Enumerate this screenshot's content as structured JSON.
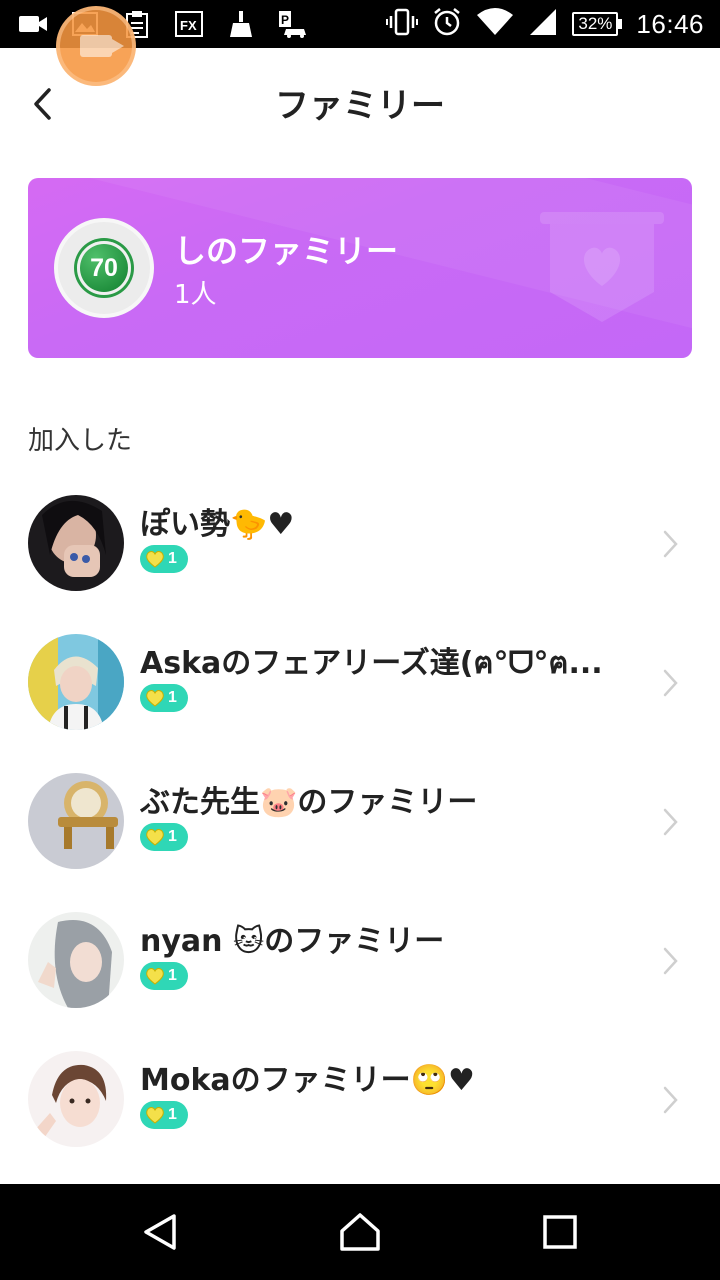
{
  "status_bar": {
    "battery": "32%",
    "time": "16:46",
    "left_icons": [
      "video-icon",
      "image-icon",
      "clipboard-icon",
      "fx-icon",
      "broom-icon",
      "parking-car-icon"
    ],
    "right_icons": [
      "vibrate-icon",
      "alarm-icon",
      "wifi-icon",
      "signal-icon"
    ]
  },
  "header": {
    "title": "ファミリー"
  },
  "family_card": {
    "level": "70",
    "name": "しのファミリー",
    "member_count": "1人",
    "colors": {
      "background": "#d06cf6",
      "badge": "#2a9a46"
    }
  },
  "section": {
    "label": "加入した"
  },
  "families": [
    {
      "name": "ぽい勢🐤♥",
      "badge_count": "1"
    },
    {
      "name": "Askaのフェアリーズ達(ฅ°ᗜ°ฅ...",
      "badge_count": "1"
    },
    {
      "name": "ぶた先生🐷のファミリー",
      "badge_count": "1"
    },
    {
      "name": "nyan 🐱のファミリー",
      "badge_count": "1"
    },
    {
      "name": "Mokaのファミリー🙄♥",
      "badge_count": "1"
    }
  ],
  "colors": {
    "badge_bg": "#2fd7b6",
    "badge_heart": "#f4e04a"
  },
  "nav": {
    "icons": [
      "back-icon",
      "home-icon",
      "recents-icon"
    ]
  }
}
